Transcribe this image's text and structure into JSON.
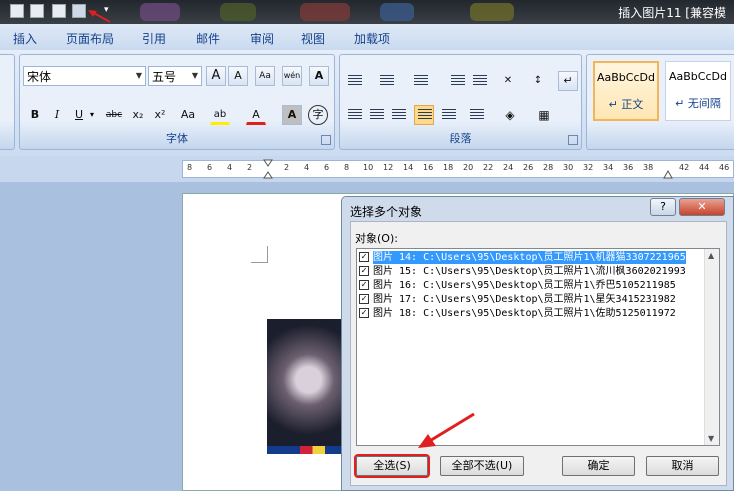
{
  "window": {
    "title": "插入图片11 [兼容模"
  },
  "tabs": [
    "插入",
    "页面布局",
    "引用",
    "邮件",
    "审阅",
    "视图",
    "加载项"
  ],
  "font": {
    "name": "宋体",
    "size": "五号",
    "group_label": "字体",
    "btn_grow": "A",
    "btn_shrink": "A",
    "btn_phonetic": "wén",
    "btn_bold": "B",
    "btn_italic": "I",
    "btn_underline": "U",
    "btn_strike": "abc",
    "btn_sub": "x₂",
    "btn_sup": "x²",
    "btn_case": "Aa",
    "btn_highlight": "ab",
    "btn_color": "A",
    "btn_shade": "A",
    "btn_enclose": "字"
  },
  "paragraph": {
    "group_label": "段落"
  },
  "styles": [
    {
      "preview": "AaBbCcDd",
      "name": "↵ 正文"
    },
    {
      "preview": "AaBbCcDd",
      "name": "↵ 无间隔"
    }
  ],
  "ruler": {
    "numbers": [
      "8",
      "6",
      "4",
      "2",
      "2",
      "4",
      "6",
      "8",
      "10",
      "12",
      "14",
      "16",
      "18",
      "20",
      "22",
      "24",
      "26",
      "28",
      "30",
      "32",
      "34",
      "36",
      "38",
      "42",
      "44",
      "46"
    ]
  },
  "dialog": {
    "title": "选择多个对象",
    "help": "?",
    "close": "✕",
    "list_label": "对象(O):",
    "items": [
      {
        "text": "图片 14: C:\\Users\\95\\Desktop\\员工照片1\\机器猫3307221965",
        "checked": true,
        "selected": true
      },
      {
        "text": "图片 15: C:\\Users\\95\\Desktop\\员工照片1\\流川枫3602021993",
        "checked": true,
        "selected": false
      },
      {
        "text": "图片 16: C:\\Users\\95\\Desktop\\员工照片1\\乔巴5105211985",
        "checked": true,
        "selected": false
      },
      {
        "text": "图片 17: C:\\Users\\95\\Desktop\\员工照片1\\星矢3415231982",
        "checked": true,
        "selected": false
      },
      {
        "text": "图片 18: C:\\Users\\95\\Desktop\\员工照片1\\佐助5125011972",
        "checked": true,
        "selected": false
      }
    ],
    "select_all": "全选(S)",
    "deselect_all": "全部不选(U)",
    "ok": "确定",
    "cancel": "取消"
  },
  "colors": {
    "accent": "#e02020",
    "selection": "#3399ff"
  }
}
